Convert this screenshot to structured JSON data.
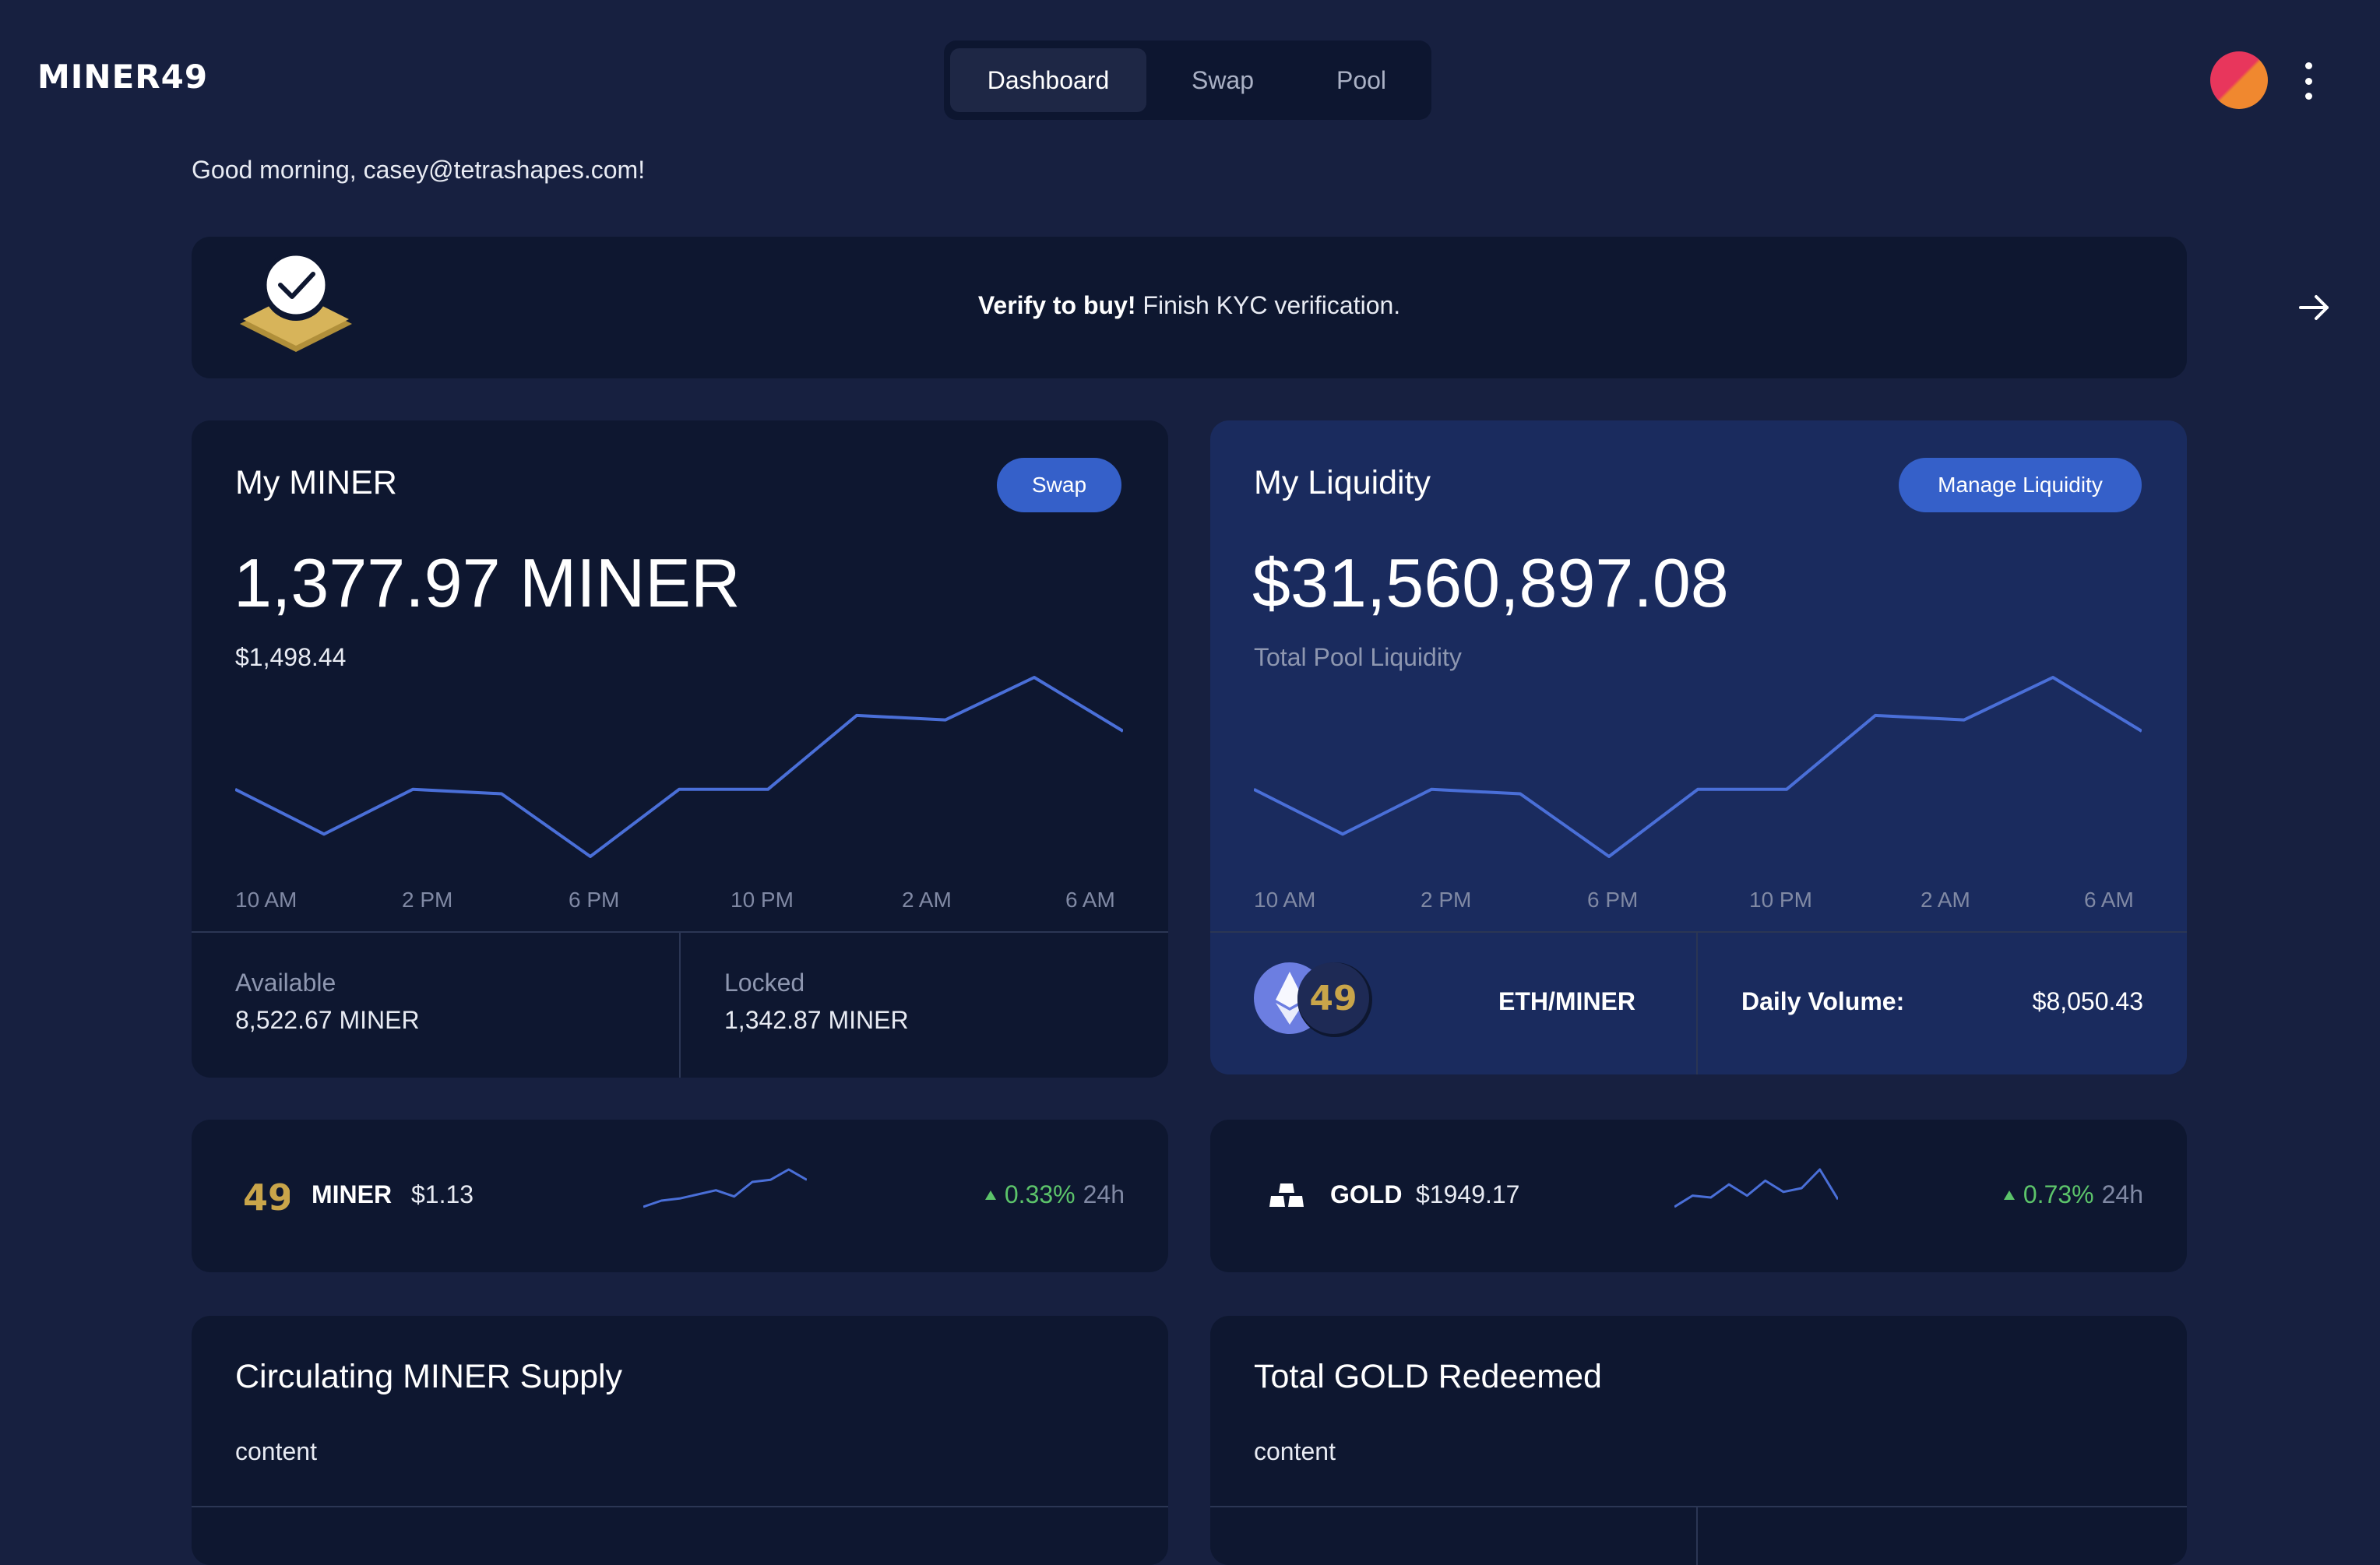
{
  "header": {
    "logo": "MINER49",
    "tabs": [
      {
        "label": "Dashboard",
        "active": true
      },
      {
        "label": "Swap",
        "active": false
      },
      {
        "label": "Pool",
        "active": false
      }
    ]
  },
  "greeting": "Good morning, casey@tetrashapes.com!",
  "kyc_banner": {
    "bold": "Verify to buy!",
    "text": " Finish KYC verification."
  },
  "my_miner": {
    "title": "My MINER",
    "button": "Swap",
    "amount": "1,377.97 MINER",
    "usd": "$1,498.44",
    "available_label": "Available",
    "available_value": "8,522.67 MINER",
    "locked_label": "Locked",
    "locked_value": "1,342.87 MINER"
  },
  "my_liquidity": {
    "title": "My Liquidity",
    "button": "Manage Liquidity",
    "amount": "$31,560,897.08",
    "subtitle": "Total Pool Liquidity",
    "pair_badge": "49",
    "pair": "ETH/MINER",
    "daily_volume_label": "Daily Volume:",
    "daily_volume_value": "$8,050.43"
  },
  "chart_data": [
    {
      "type": "line",
      "x": [
        "10 AM",
        "2 PM",
        "6 PM",
        "10 PM",
        "2 AM",
        "6 AM"
      ],
      "values": [
        5,
        3,
        5,
        4.8,
        2,
        5,
        5,
        8.3,
        8.1,
        10,
        7.6
      ]
    },
    {
      "type": "line",
      "x": [
        "10 AM",
        "2 PM",
        "6 PM",
        "10 PM",
        "2 AM",
        "6 AM"
      ],
      "values": [
        5,
        3,
        5,
        4.8,
        2,
        5,
        5,
        8.3,
        8.1,
        10,
        7.6
      ]
    }
  ],
  "tickers": [
    {
      "icon": "miner49-logo-icon",
      "logo": "49",
      "name": "MINER",
      "price": "$1.13",
      "change": "0.33%",
      "period": "24h",
      "spark": [
        2,
        3.5,
        4,
        5,
        6,
        4.5,
        8,
        8.5,
        11,
        8.5
      ]
    },
    {
      "icon": "gold-bars-icon",
      "name": "GOLD",
      "price": "$1949.17",
      "change": "0.73%",
      "period": "24h",
      "spark": [
        2,
        5,
        4.5,
        8,
        5,
        9,
        6,
        7,
        12,
        4
      ]
    }
  ],
  "bottom_cards": [
    {
      "title": "Circulating MINER Supply",
      "content": "content"
    },
    {
      "title": "Total GOLD Redeemed",
      "content": "content"
    }
  ],
  "colors": {
    "background": "#172040",
    "card": "#0e1730",
    "card_blue": "#1a2b5e",
    "accent": "#3560c9",
    "line": "#4a6fd8",
    "positive": "#5cc46a",
    "gold": "#c9a54a"
  }
}
